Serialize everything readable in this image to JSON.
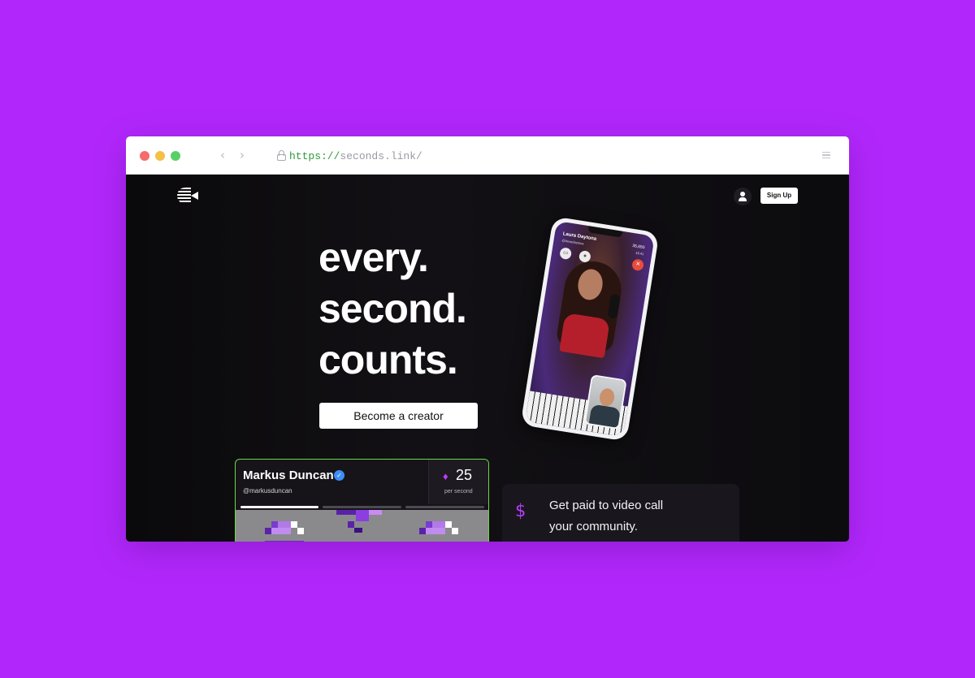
{
  "browser": {
    "url_protocol": "https://",
    "url_rest": "seconds.link/",
    "back_glyph": "‹",
    "forward_glyph": "›"
  },
  "nav": {
    "signup_label": "Sign Up"
  },
  "hero": {
    "line1": "every.",
    "line2": "second.",
    "line3": "counts.",
    "cta_label": "Become a creator"
  },
  "phone": {
    "name": "Laura Daytona",
    "handle": "@lauradaytona",
    "stat1": "35,650",
    "stat2": "16.41",
    "camera_glyph": "▭",
    "mic_glyph": "●",
    "end_glyph": "✕"
  },
  "creator_card": {
    "name": "Markus Duncan",
    "verified_glyph": "✓",
    "handle": "@markusduncan",
    "diamond_glyph": "♦",
    "rate": "25",
    "rate_label": "per second"
  },
  "feature": {
    "icon_glyph": "$",
    "line1": "Get paid to video call",
    "line2": "your community."
  },
  "colors": {
    "background": "#b127fb",
    "accent_purple": "#c03aff",
    "card_border_green": "#69d847",
    "verified_blue": "#3d8ef5",
    "end_call_red": "#e94b3c"
  }
}
